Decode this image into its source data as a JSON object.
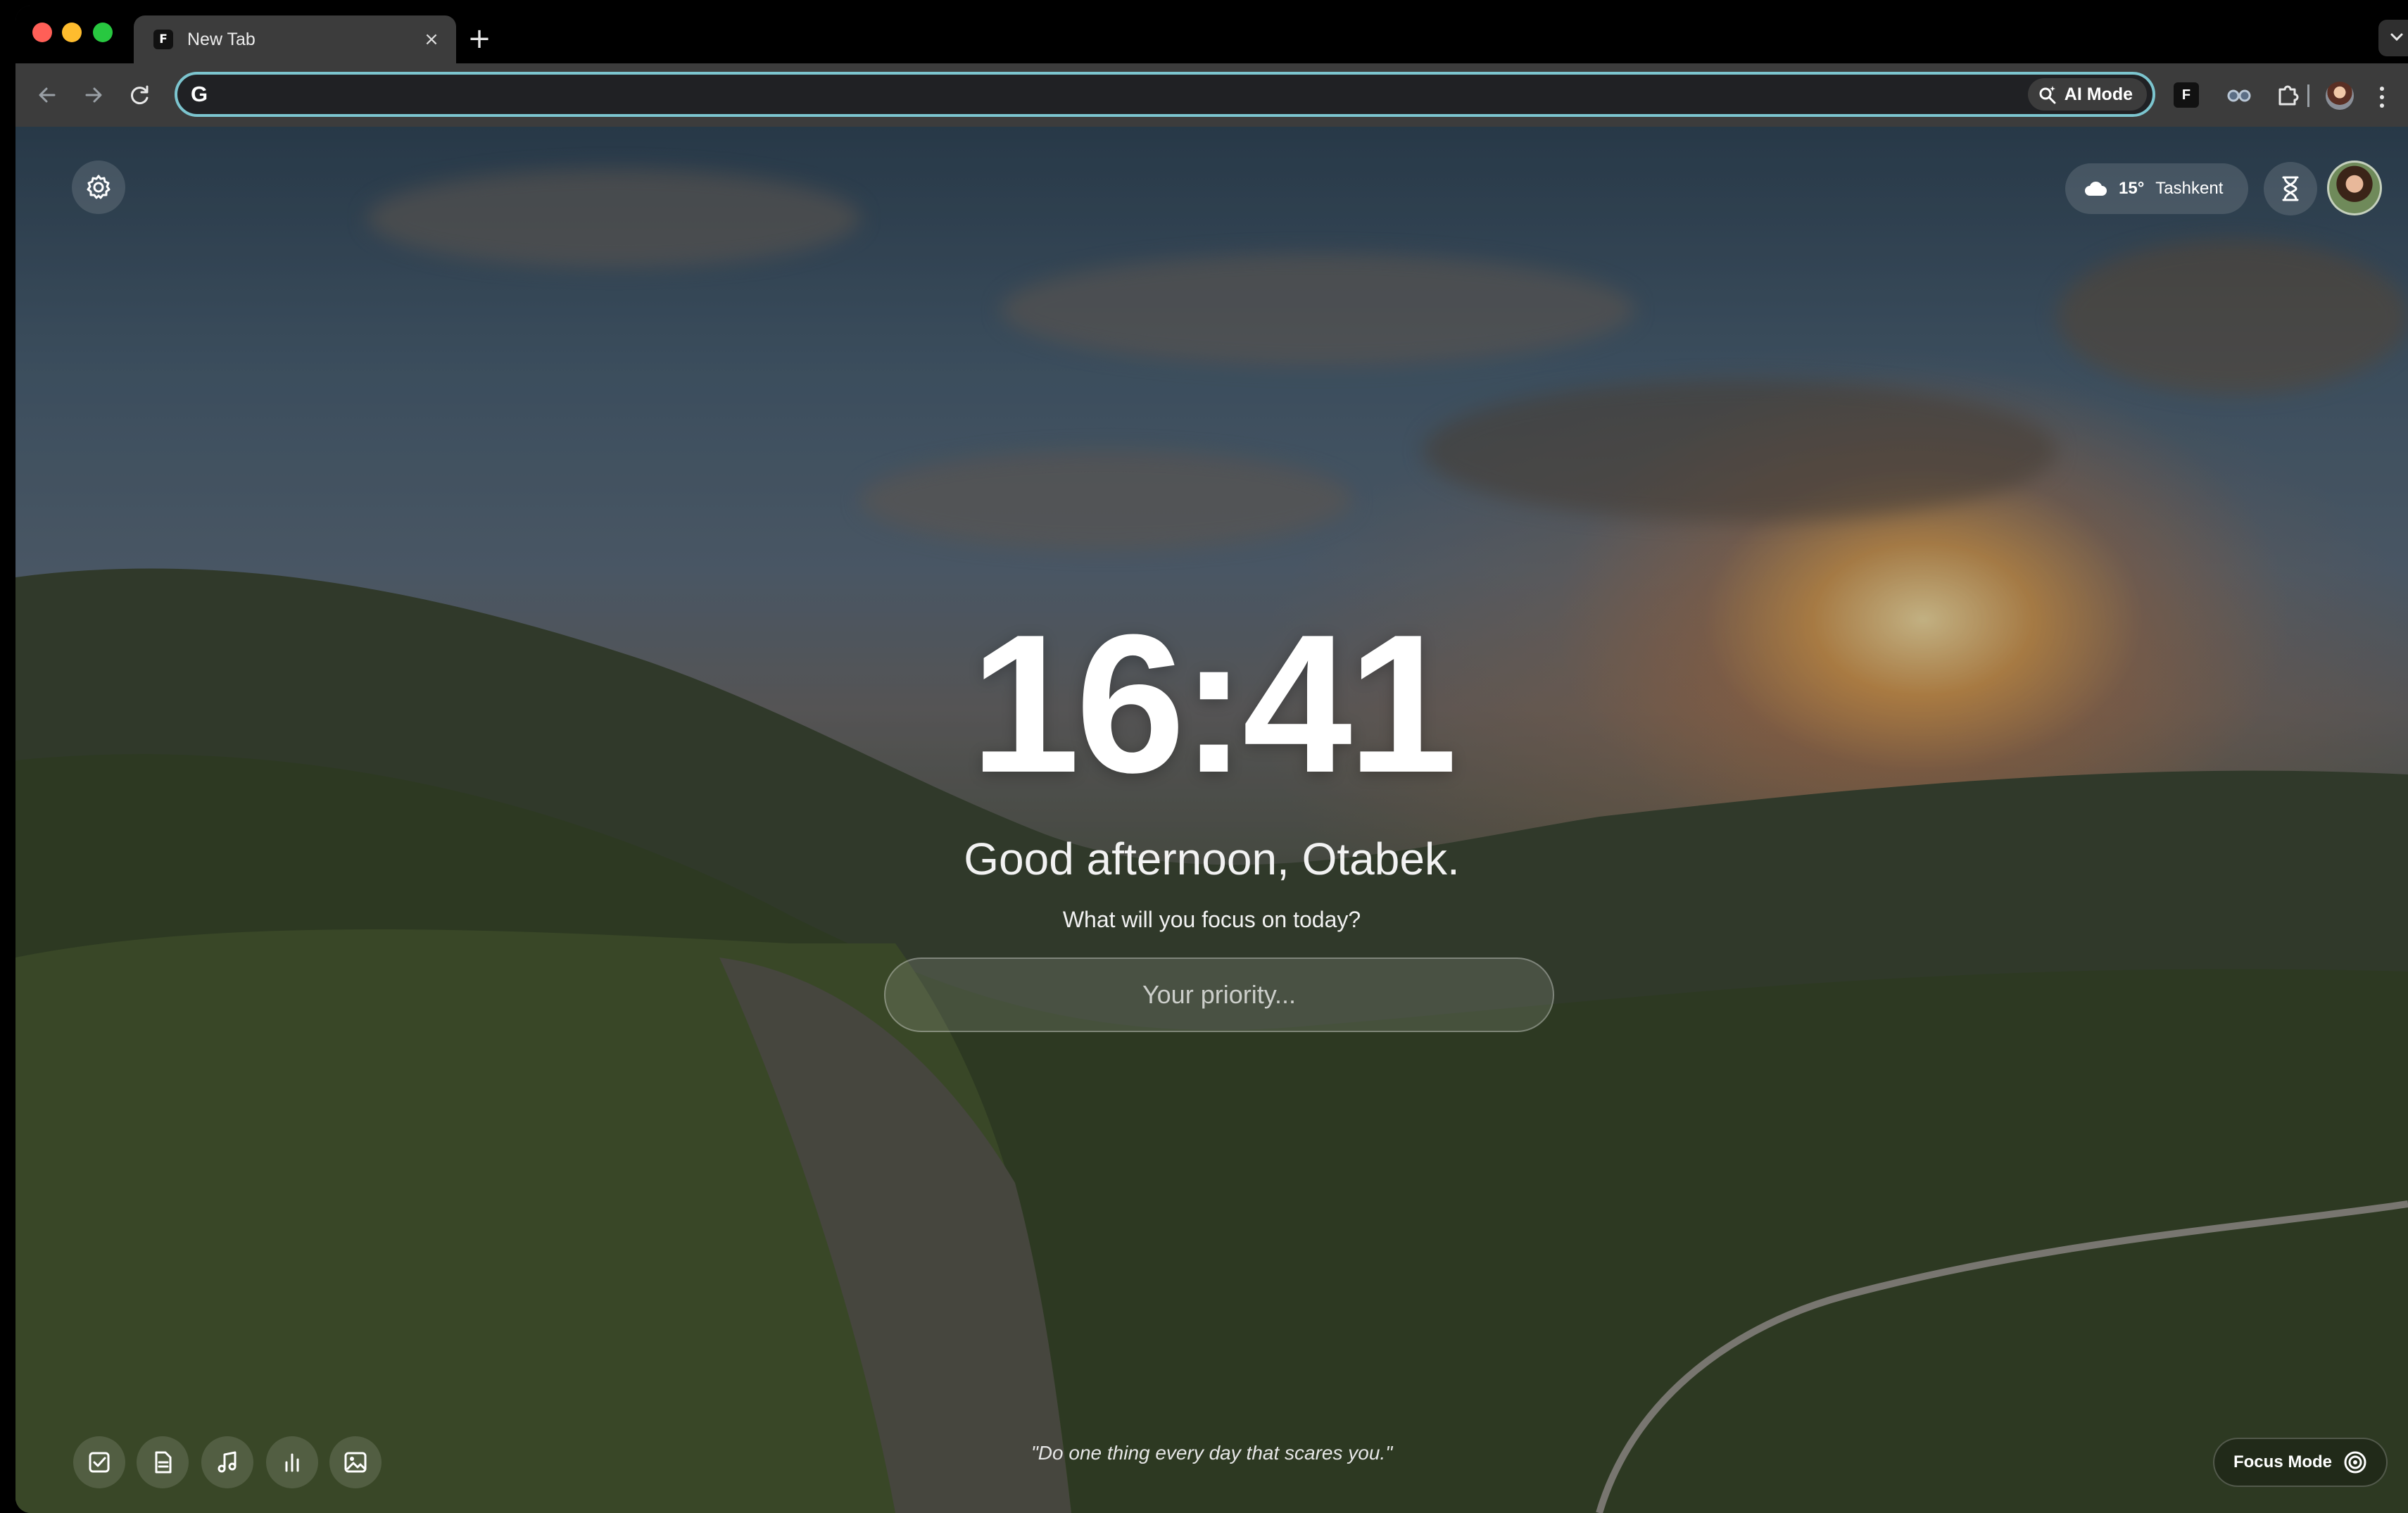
{
  "tab": {
    "favicon_letter": "F",
    "title": "New Tab",
    "close_glyph": "×"
  },
  "tabstrip": {
    "new_tab_glyph": "+"
  },
  "toolbar": {
    "omnibox_icon": "G",
    "omnibox_value": "",
    "ai_mode_label": "AI Mode",
    "extension_letter": "F"
  },
  "weather": {
    "temperature": "15°",
    "city": "Tashkent",
    "icon": "cloud-icon"
  },
  "clock": {
    "time": "16:41"
  },
  "greeting": "Good afternoon, Otabek.",
  "focus_prompt": "What will you focus on today?",
  "priority_placeholder": "Your priority...",
  "quote": "\"Do one thing every day that scares you.\"",
  "focus_mode": {
    "label": "Focus Mode",
    "icon": "target-icon"
  },
  "dock": [
    {
      "name": "todo",
      "icon": "checkbox-icon"
    },
    {
      "name": "notes",
      "icon": "document-icon"
    },
    {
      "name": "music",
      "icon": "music-note-icon"
    },
    {
      "name": "stats",
      "icon": "bar-chart-icon"
    },
    {
      "name": "background",
      "icon": "image-icon"
    }
  ],
  "colors": {
    "omnibox_focus": "#7cc5cf",
    "tab_active": "#3c3c3c",
    "toolbar": "#3c3c3c"
  }
}
